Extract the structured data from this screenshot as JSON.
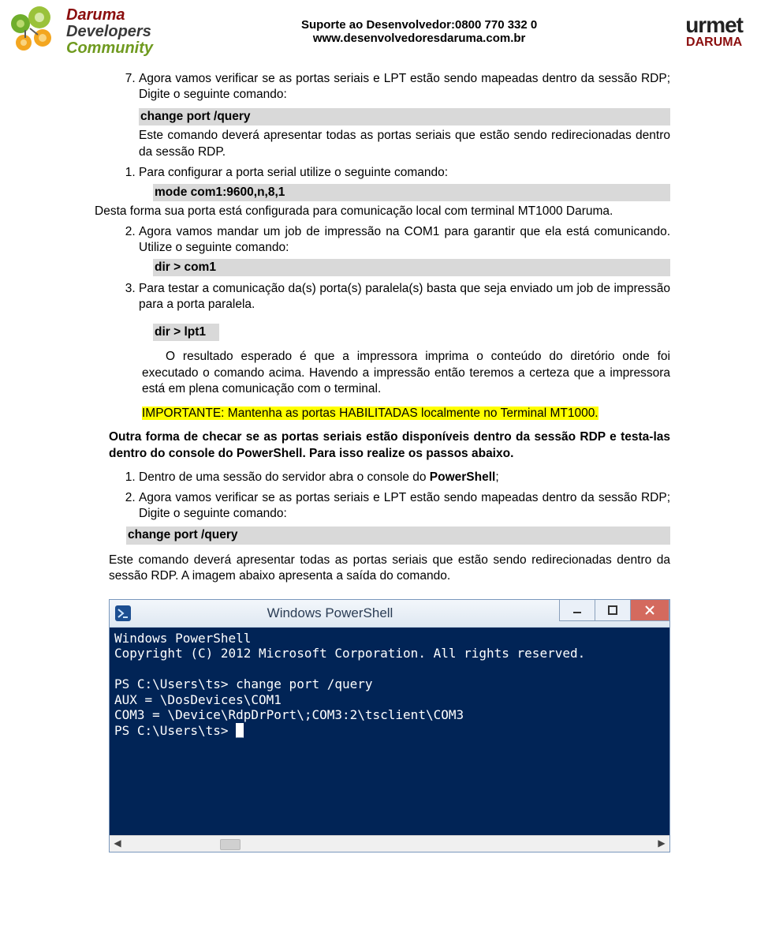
{
  "header": {
    "left_logo_top": "Daruma",
    "left_logo_mid": "Developers",
    "left_logo_bot": "Community",
    "support_line1": "Suporte ao Desenvolvedor:0800 770 332 0",
    "support_line2": "www.desenvolvedoresdaruma.com.br",
    "right_brand_top": "urmet",
    "right_brand_bot": "DARUMA"
  },
  "body": {
    "step7_text": "Agora vamos verificar se as portas seriais e LPT estão sendo mapeadas dentro da sessão RDP; Digite o seguinte comando:",
    "cmd_change_port": "change port /query",
    "after_change_port": "Este comando deverá apresentar todas as portas seriais que estão sendo redirecionadas dentro da sessão RDP.",
    "sub1_a": "Para configurar a porta serial utilize o seguinte comando:",
    "sub1_cmd": "mode com1:9600,n,8,1",
    "sub1_b": "Desta forma sua porta está configurada para comunicação local com terminal MT1000 Daruma.",
    "sub2_a": "Agora vamos mandar um job de impressão na COM1 para garantir que ela está comunicando. Utilize o seguinte comando:",
    "sub2_cmd": "dir > com1",
    "sub3_a": "Para testar a comunicação da(s) porta(s) paralela(s) basta que seja enviado um job de impressão para a porta paralela.",
    "sub3_cmd": "dir > lpt1",
    "result_para": "O resultado esperado é que a impressora imprima o conteúdo do diretório onde foi executado o comando acima. Havendo a impressão então teremos a certeza que a impressora está em plena comunicação com o terminal.",
    "important": "IMPORTANTE: Mantenha as portas HABILITADAS localmente no Terminal MT1000.",
    "other_way_a": "Outra forma de checar se as portas seriais estão disponíveis dentro da sessão RDP e testa-las dentro do console do PowerShell. Para isso realize os passos abaixo.",
    "ps_step1": "PowerShell",
    "ps_step1_pre": "Dentro de uma sessão do servidor abra o console do ",
    "ps_step1_post": ";",
    "ps_step2": "Agora vamos verificar se as portas seriais e LPT estão sendo mapeadas dentro da sessão RDP; Digite o seguinte comando:",
    "after_cmd_para": "Este comando deverá apresentar todas as portas seriais que estão sendo redirecionadas dentro da sessão RDP. A imagem abaixo apresenta a saída do comando."
  },
  "powershell": {
    "title": "Windows PowerShell",
    "line1": "Windows PowerShell",
    "line2": "Copyright (C) 2012 Microsoft Corporation. All rights reserved.",
    "line3": "",
    "line4": "PS C:\\Users\\ts> change port /query",
    "line5": "AUX = \\DosDevices\\COM1",
    "line6": "COM3 = \\Device\\RdpDrPort\\;COM3:2\\tsclient\\COM3",
    "line7_prefix": "PS C:\\Users\\ts> ",
    "cursor": "_"
  }
}
